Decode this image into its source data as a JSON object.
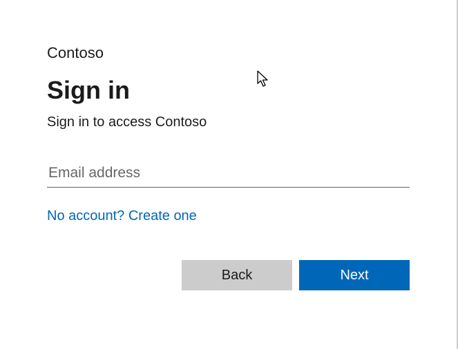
{
  "brand": "Contoso",
  "title": "Sign in",
  "subtitle": "Sign in to access Contoso",
  "email": {
    "placeholder": "Email address",
    "value": ""
  },
  "create_account_link": "No account? Create one",
  "buttons": {
    "back": "Back",
    "next": "Next"
  },
  "colors": {
    "primary": "#0067b8",
    "secondary": "#cccccc"
  }
}
